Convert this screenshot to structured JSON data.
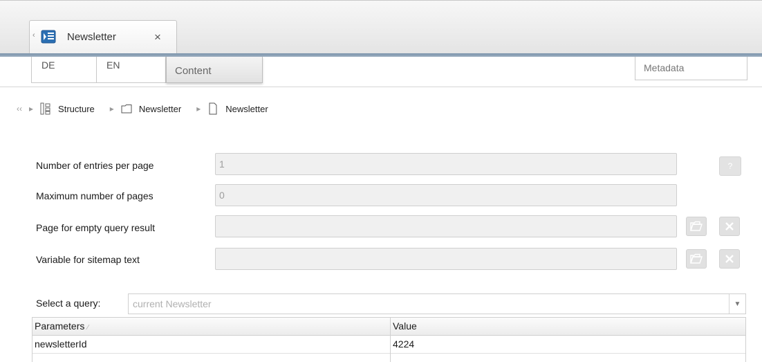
{
  "tabs": [
    {
      "label": "Newsletter",
      "close_glyph": "×",
      "icon": "newsletter-document-icon",
      "scroll_glyph": "‹"
    }
  ],
  "langbar": {
    "languages": [
      "DE",
      "EN"
    ],
    "content_label": "Content",
    "metadata_label": "Metadata"
  },
  "breadcrumb": {
    "back_glyph": "‹‹",
    "separator_glyph": "▸",
    "items": [
      {
        "label": "Structure",
        "icon": "structure-icon"
      },
      {
        "label": "Newsletter",
        "icon": "folder-icon"
      },
      {
        "label": "Newsletter",
        "icon": "page-icon"
      }
    ]
  },
  "form": {
    "fields": [
      {
        "label": "Number of entries per page",
        "value": "1"
      },
      {
        "label": "Maximum number of pages",
        "value": "0"
      },
      {
        "label": "Page for empty query result",
        "value": ""
      },
      {
        "label": "Variable for sitemap text",
        "value": ""
      }
    ],
    "help_glyph": "?"
  },
  "query": {
    "label": "Select a query:",
    "selected": "current Newsletter",
    "caret_glyph": "▼"
  },
  "grid": {
    "columns": [
      "Parameters",
      "Value"
    ],
    "sort_glyph": "⁄",
    "rows": [
      [
        "newsletterId",
        "4224"
      ]
    ]
  },
  "colors": {
    "tab_rule": "#8aa0b6",
    "field_bg": "#f0f0f0",
    "muted_text": "#9d9d9d"
  }
}
